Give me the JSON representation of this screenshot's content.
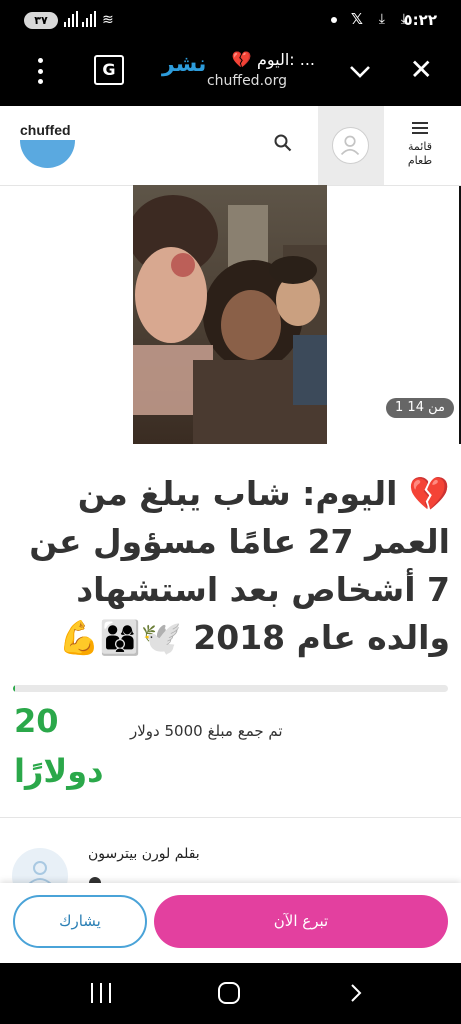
{
  "status_bar": {
    "time": "٥:٢٢",
    "battery": "٣٧",
    "icons": [
      "download-icon",
      "download-icon",
      "x-app-icon",
      "notification-dot",
      "wifi-icon",
      "signal-icon",
      "signal-icon"
    ]
  },
  "custom_tab": {
    "title": "💔 اليوم: ...",
    "url": "chuffed.org",
    "share_label": "نشر",
    "translate_icon": "google-translate-icon",
    "close_icon": "close-icon",
    "expand_icon": "chevron-down-icon",
    "menu_icon": "more-vert-icon"
  },
  "site_header": {
    "logo_text": "chuffed",
    "menu_label_line1": "قائمة",
    "menu_label_line2": "طعام",
    "search_icon": "search-icon",
    "avatar_icon": "user-avatar-icon"
  },
  "media": {
    "counter": "1 من 14"
  },
  "campaign": {
    "title": "💔 اليوم: شاب يبلغ من العمر 27 عامًا مسؤول عن 7 أشخاص بعد استشهاد والده عام 2018 🕊️👨‍👩‍👦💪",
    "raised_amount": "20",
    "raised_currency": "دولارًا",
    "goal_text": "تم جمع مبلغ 5000 دولار",
    "progress_fraction": 0.004,
    "author": "بقلم لورن بيترسون"
  },
  "actions": {
    "share_label": "يشارك",
    "donate_label": "تبرع الآن"
  },
  "colors": {
    "accent_green": "#2ba84a",
    "donate_pink": "#e3409f",
    "share_blue": "#4aa3d8",
    "logo_blue": "#5aa9e0"
  },
  "nav_bar": {
    "icons": [
      "recent-apps-icon",
      "home-icon",
      "back-icon"
    ]
  }
}
